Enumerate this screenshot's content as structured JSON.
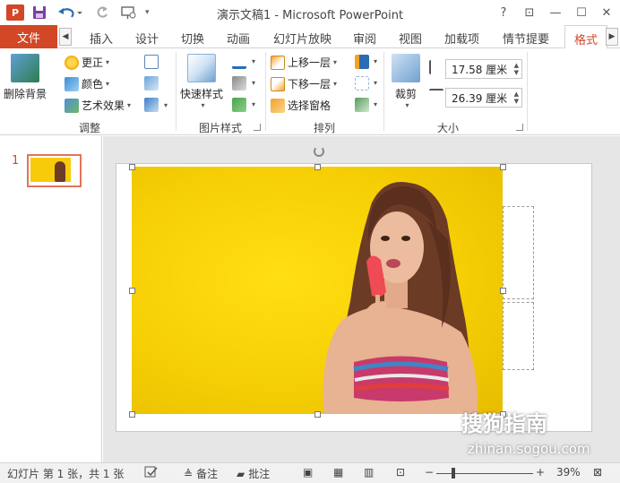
{
  "window": {
    "title": "演示文稿1 - Microsoft PowerPoint",
    "logo_text": "P",
    "controls": {
      "help": "?",
      "ribbon_display": "⊡",
      "minimize": "—",
      "maximize": "☐",
      "close": "✕"
    }
  },
  "tabs": {
    "file": "文件",
    "items": [
      "插入",
      "设计",
      "切换",
      "动画",
      "幻灯片放映",
      "审阅",
      "视图",
      "加载项",
      "情节提要",
      "格式"
    ],
    "active": "格式"
  },
  "ribbon": {
    "adjust": {
      "remove_bg": "删除背景",
      "corrections": "更正",
      "color": "颜色",
      "artistic": "艺术效果",
      "label": "调整"
    },
    "picture_styles": {
      "quick_styles": "快速样式",
      "label": "图片样式"
    },
    "arrange": {
      "bring_forward": "上移一层",
      "send_backward": "下移一层",
      "selection_pane": "选择窗格",
      "label": "排列"
    },
    "size": {
      "crop": "裁剪",
      "height": "17.58 厘米",
      "width": "26.39 厘米",
      "label": "大小"
    }
  },
  "thumbnails": {
    "slide_number": "1"
  },
  "watermark": {
    "brand": "搜狗指南",
    "url": "zhinan.sogou.com"
  },
  "status": {
    "slide_info": "幻灯片 第 1 张，共 1 张",
    "notes": "备注",
    "comments": "批注",
    "zoom_minus": "−",
    "zoom_plus": "+",
    "zoom_percent": "39%",
    "zoom_level": 0.39
  },
  "colors": {
    "accent": "#d24726",
    "picture_bg": "#f6cf05"
  }
}
